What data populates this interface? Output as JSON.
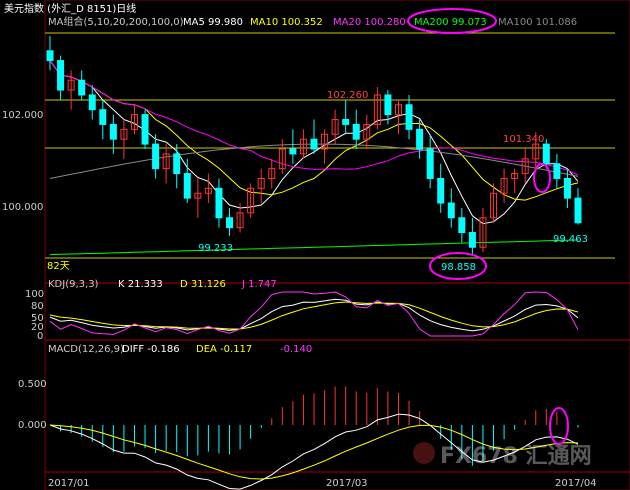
{
  "header": {
    "title": "美元指数 (外汇_D 8151)日线",
    "ma_label": "MA组合(5,10,20,200,100,0)",
    "ma5": "MA5 99.980",
    "ma10": "MA10 100.352",
    "ma20": "MA20 100.280",
    "ma200": "MA200 99.073",
    "ma100": "MA100 101.086"
  },
  "colors": {
    "background": "#000000",
    "up": "#ff3333",
    "down": "#00ffff",
    "ma5": "#ffffff",
    "ma10": "#ffff00",
    "ma20": "#ff00ff",
    "ma200": "#00ff00",
    "ma100": "#888888",
    "highlight": "#ff00ff"
  },
  "annotations": {
    "high1": "102.260",
    "high2": "101.340",
    "low1": "99.233",
    "low2": "98.858",
    "last": "99.463",
    "days": "82天"
  },
  "kdj": {
    "label": "KDJ(9,3,3)",
    "k": "K  21.333",
    "d": "D  31.126",
    "j": "J  1.747"
  },
  "macd": {
    "label": "MACD(12,26,9)",
    "diff": "DIFF  -0.186",
    "dea": "DEA  -0.117",
    "macd": "-0.140"
  },
  "footer": {
    "date1": "2017/01",
    "date2": "2017/03",
    "date3": "2017/04",
    "watermark": "FX678 汇通网"
  },
  "chart_data": [
    {
      "type": "candlestick",
      "title": "美元指数 (外汇_D 8151)日线",
      "ylim": [
        98.7,
        103.3
      ],
      "y_ticks": [
        100.0,
        102.0
      ],
      "candles": [
        [
          103.0,
          103.3,
          102.6,
          102.8
        ],
        [
          102.8,
          102.9,
          102.0,
          102.2
        ],
        [
          102.2,
          102.6,
          101.8,
          102.4
        ],
        [
          102.4,
          102.6,
          102.0,
          102.1
        ],
        [
          102.1,
          102.3,
          101.6,
          101.8
        ],
        [
          101.8,
          102.0,
          101.2,
          101.5
        ],
        [
          101.5,
          101.7,
          100.9,
          101.2
        ],
        [
          101.2,
          101.6,
          100.8,
          101.4
        ],
        [
          101.4,
          101.9,
          101.3,
          101.7
        ],
        [
          101.7,
          101.8,
          101.0,
          101.1
        ],
        [
          101.1,
          101.3,
          100.4,
          100.6
        ],
        [
          100.6,
          101.1,
          100.3,
          100.9
        ],
        [
          100.9,
          101.1,
          100.2,
          100.5
        ],
        [
          100.5,
          100.8,
          99.9,
          100.0
        ],
        [
          100.0,
          100.4,
          99.6,
          100.1
        ],
        [
          100.1,
          100.5,
          99.9,
          100.2
        ],
        [
          100.2,
          100.4,
          99.4,
          99.6
        ],
        [
          99.6,
          99.8,
          99.233,
          99.4
        ],
        [
          99.4,
          99.9,
          99.3,
          99.7
        ],
        [
          99.7,
          100.3,
          99.6,
          100.2
        ],
        [
          100.2,
          100.6,
          99.9,
          100.4
        ],
        [
          100.4,
          100.8,
          100.2,
          100.6
        ],
        [
          100.6,
          101.2,
          100.5,
          101.0
        ],
        [
          101.0,
          101.4,
          100.7,
          100.9
        ],
        [
          100.9,
          101.4,
          100.8,
          101.2
        ],
        [
          101.2,
          101.6,
          100.9,
          101.0
        ],
        [
          101.0,
          101.4,
          100.7,
          101.3
        ],
        [
          101.3,
          101.8,
          101.1,
          101.6
        ],
        [
          101.6,
          102.0,
          101.3,
          101.5
        ],
        [
          101.5,
          101.8,
          101.0,
          101.2
        ],
        [
          101.2,
          101.7,
          101.0,
          101.5
        ],
        [
          101.5,
          102.26,
          101.4,
          102.1
        ],
        [
          102.1,
          102.2,
          101.5,
          101.7
        ],
        [
          101.7,
          102.0,
          101.3,
          101.9
        ],
        [
          101.9,
          102.1,
          101.2,
          101.4
        ],
        [
          101.4,
          101.6,
          100.8,
          101.0
        ],
        [
          101.0,
          101.3,
          100.2,
          100.4
        ],
        [
          100.4,
          100.7,
          99.7,
          99.9
        ],
        [
          99.9,
          100.2,
          99.4,
          99.6
        ],
        [
          99.6,
          99.8,
          99.1,
          99.3
        ],
        [
          99.3,
          99.6,
          98.858,
          99.0
        ],
        [
          99.0,
          99.8,
          98.9,
          99.6
        ],
        [
          99.6,
          100.3,
          99.5,
          100.1
        ],
        [
          100.1,
          100.6,
          99.9,
          100.4
        ],
        [
          100.4,
          100.6,
          100.1,
          100.5
        ],
        [
          100.5,
          101.0,
          100.3,
          100.8
        ],
        [
          100.8,
          101.34,
          100.6,
          101.1
        ],
        [
          101.1,
          101.2,
          100.6,
          100.7
        ],
        [
          100.7,
          100.9,
          100.2,
          100.4
        ],
        [
          100.4,
          100.6,
          99.8,
          100.0
        ],
        [
          100.0,
          100.2,
          99.463,
          99.5
        ]
      ],
      "series": [
        {
          "name": "MA5",
          "value": 99.98
        },
        {
          "name": "MA10",
          "value": 100.352
        },
        {
          "name": "MA20",
          "value": 100.28
        },
        {
          "name": "MA200",
          "value": 99.073
        },
        {
          "name": "MA100",
          "value": 101.086
        }
      ],
      "annotations": [
        {
          "text": "102.260",
          "value": 102.26
        },
        {
          "text": "101.340",
          "value": 101.34
        },
        {
          "text": "99.233",
          "value": 99.233
        },
        {
          "text": "98.858",
          "value": 98.858
        },
        {
          "text": "99.463",
          "value": 99.463
        }
      ]
    },
    {
      "type": "line",
      "title": "KDJ(9,3,3)",
      "ylim": [
        0,
        100
      ],
      "y_ticks": [
        0,
        20,
        50,
        80,
        100
      ],
      "series": [
        {
          "name": "K",
          "last": 21.333
        },
        {
          "name": "D",
          "last": 31.126
        },
        {
          "name": "J",
          "last": 1.747
        }
      ]
    },
    {
      "type": "bar",
      "title": "MACD(12,26,9)",
      "ylim": [
        -1.0,
        1.1
      ],
      "y_ticks": [
        0.0,
        0.5
      ],
      "series": [
        {
          "name": "DIFF",
          "last": -0.186
        },
        {
          "name": "DEA",
          "last": -0.117
        },
        {
          "name": "MACD",
          "last": -0.14
        }
      ],
      "categories": [
        "2017/01",
        "2017/03",
        "2017/04"
      ]
    }
  ]
}
